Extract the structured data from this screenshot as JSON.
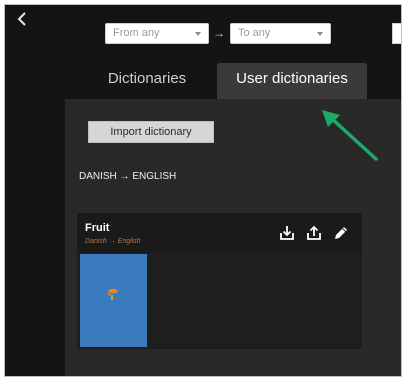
{
  "header": {
    "back_icon": "chevron-left-icon",
    "from_select": {
      "value": "From any"
    },
    "to_select": {
      "value": "To any"
    },
    "separator": "→"
  },
  "tabs": [
    {
      "label": "Dictionaries",
      "active": false
    },
    {
      "label": "User dictionaries",
      "active": true
    }
  ],
  "panel": {
    "import_button": "Import dictionary",
    "language_pair": "DANISH → ENGLISH",
    "dictionaries": [
      {
        "title": "Fruit",
        "subtitle": "Danish → English",
        "actions": [
          "download-icon",
          "upload-icon",
          "pencil-icon"
        ]
      }
    ]
  },
  "colors": {
    "background": "#141414",
    "panel": "#292929",
    "active_tab": "#3a3a3a",
    "thumbnail": "#3b7bbd",
    "annotation_arrow": "#1aaa6a"
  }
}
